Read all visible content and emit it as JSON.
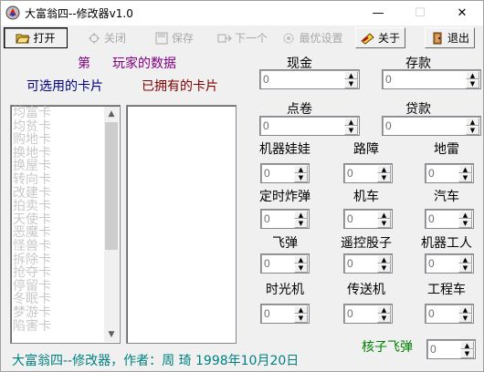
{
  "window": {
    "title": "大富翁四--修改器v1.0",
    "minimize": "—",
    "maximize": "☐",
    "close": "✕"
  },
  "toolbar": {
    "open": "打开",
    "close": "关闭",
    "save": "保存",
    "next": "下一个",
    "best": "最优设置",
    "about": "关于",
    "exit": "退出"
  },
  "header": {
    "ordinal": "第",
    "player_data": "玩家的数据",
    "available_cards": "可选用的卡片",
    "owned_cards": "已拥有的卡片"
  },
  "cards": {
    "available": [
      "均富卡",
      "均贫卡",
      "购地卡",
      "换地卡",
      "换屋卡",
      "转向卡",
      "改建卡",
      "拍卖卡",
      "天使卡",
      "恶魔卡",
      "怪兽卡",
      "拆除卡",
      "抢夺卡",
      "停留卡",
      "冬眠卡",
      "梦游卡",
      "陷害卡"
    ],
    "owned": []
  },
  "fields": {
    "cash": {
      "label": "现金",
      "value": "0"
    },
    "deposit": {
      "label": "存款",
      "value": "0"
    },
    "coupon": {
      "label": "点卷",
      "value": "0"
    },
    "loan": {
      "label": "贷款",
      "value": "0"
    },
    "robot_doll": {
      "label": "机器娃娃",
      "value": "0"
    },
    "roadblock": {
      "label": "路障",
      "value": "0"
    },
    "mine": {
      "label": "地雷",
      "value": "0"
    },
    "time_bomb": {
      "label": "定时炸弹",
      "value": "0"
    },
    "motorcycle": {
      "label": "机车",
      "value": "0"
    },
    "car": {
      "label": "汽车",
      "value": "0"
    },
    "missile": {
      "label": "飞弹",
      "value": "0"
    },
    "remote_dice": {
      "label": "遥控股子",
      "value": "0"
    },
    "robot_worker": {
      "label": "机器工人",
      "value": "0"
    },
    "time_machine": {
      "label": "时光机",
      "value": "0"
    },
    "teleporter": {
      "label": "传送机",
      "value": "0"
    },
    "engineering_car": {
      "label": "工程车",
      "value": "0"
    },
    "nuke_missile": {
      "label": "核子飞弹",
      "value": "0"
    }
  },
  "footer": {
    "credit": "大富翁四--修改器，作者：周 琦  1998年10月20日"
  },
  "colors": {
    "purple": "#800080",
    "navy": "#000080",
    "maroon": "#800000",
    "teal": "#008080",
    "green": "#008000"
  }
}
